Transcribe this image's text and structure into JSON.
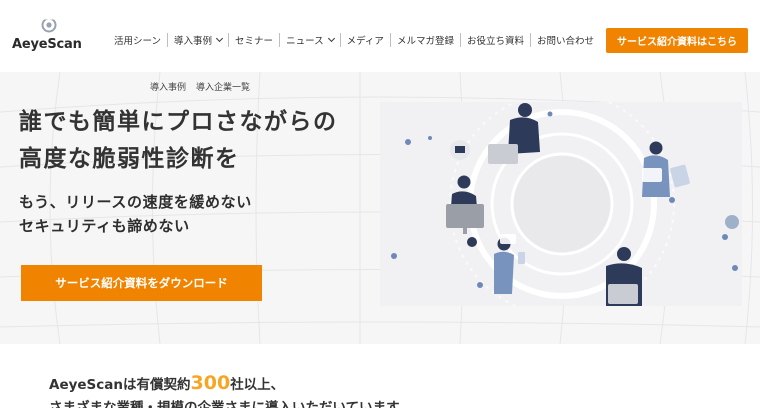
{
  "brand": {
    "name": "AeyeScan"
  },
  "nav": {
    "items": [
      {
        "label": "活用シーン",
        "dropdown": false
      },
      {
        "label": "導入事例",
        "dropdown": true
      },
      {
        "label": "セミナー",
        "dropdown": false
      },
      {
        "label": "ニュース",
        "dropdown": true
      },
      {
        "label": "メディア",
        "dropdown": false
      },
      {
        "label": "メルマガ登録",
        "dropdown": false
      },
      {
        "label": "お役立ち資料",
        "dropdown": false
      },
      {
        "label": "お問い合わせ",
        "dropdown": false
      }
    ],
    "cta_label": "サービス紹介資料はこちら"
  },
  "hero": {
    "subnav": [
      "導入事例",
      "導入企業一覧"
    ],
    "headline_line1": "誰でも簡単にプロさながらの",
    "headline_line2": "高度な脆弱性診断を",
    "subhead_line1": "もう、リリースの速度を緩めない",
    "subhead_line2": "セキュリティも諦めない",
    "cta_label": "サービス紹介資料をダウンロード"
  },
  "stats": {
    "prefix": "AeyeScanは有償契約",
    "count": "300",
    "suffix": "社以上、",
    "line2": "さまざまな業種・規模の企業さまに導入いただいています"
  },
  "colors": {
    "accent": "#f08300",
    "highlight": "#f6a623",
    "navy": "#2d3a5a"
  }
}
